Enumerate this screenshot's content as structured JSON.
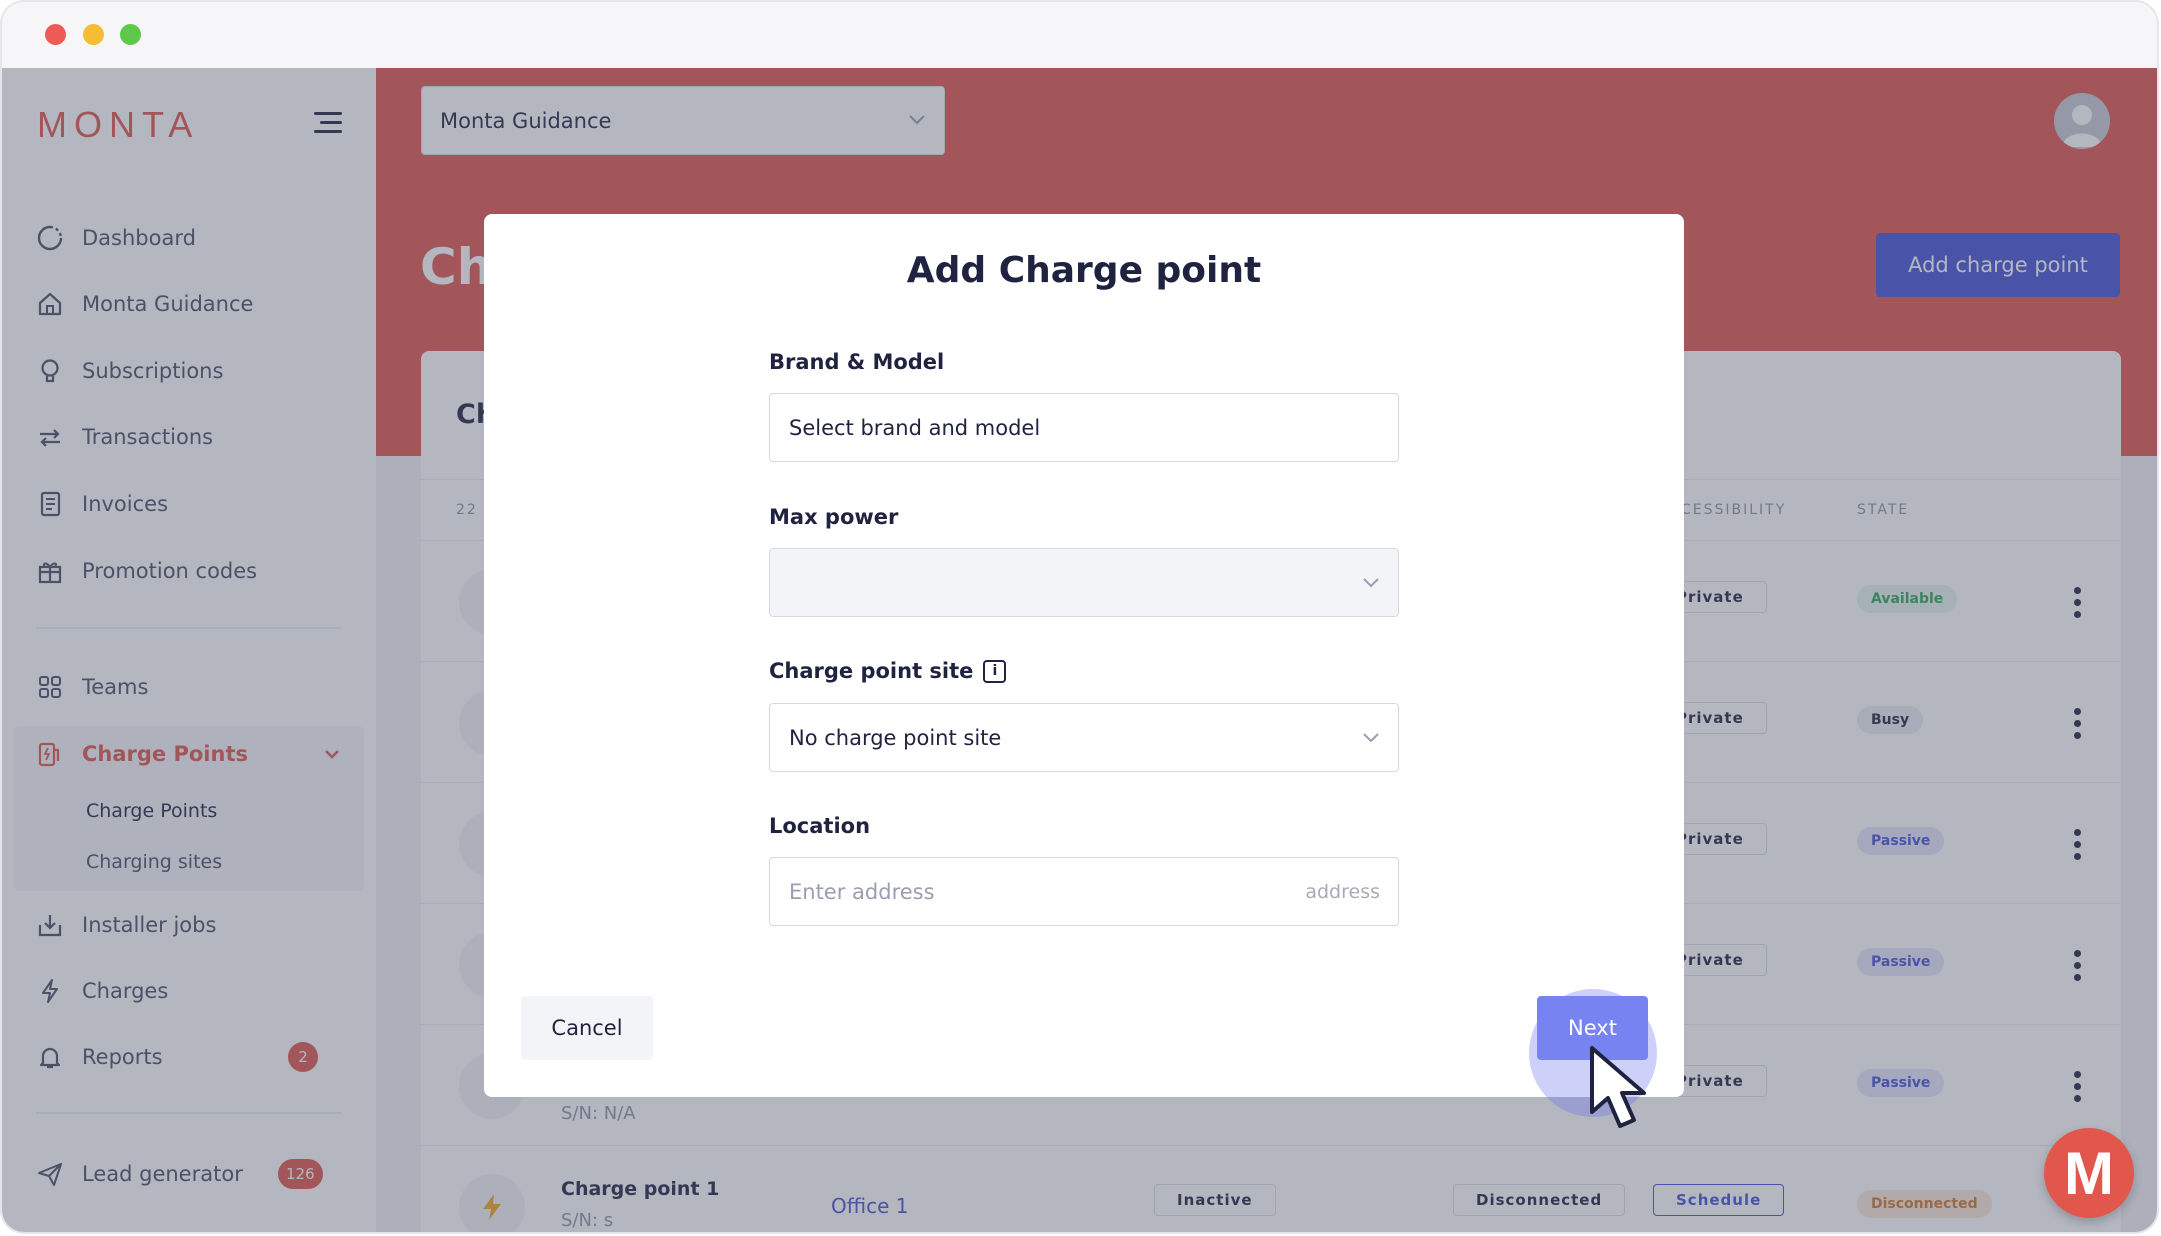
{
  "window": {
    "title": ""
  },
  "sidebar": {
    "logo": "MONTA",
    "items": [
      {
        "label": "Dashboard",
        "icon": "dashboard-icon"
      },
      {
        "label": "Monta Guidance",
        "icon": "home-icon"
      },
      {
        "label": "Subscriptions",
        "icon": "bulb-icon"
      },
      {
        "label": "Transactions",
        "icon": "arrows-icon"
      },
      {
        "label": "Invoices",
        "icon": "invoice-icon"
      },
      {
        "label": "Promotion codes",
        "icon": "gift-icon"
      },
      {
        "label": "Teams",
        "icon": "grid-icon"
      },
      {
        "label": "Charge Points",
        "icon": "charger-icon"
      },
      {
        "label": "Installer jobs",
        "icon": "download-icon"
      },
      {
        "label": "Charges",
        "icon": "bolt-icon"
      },
      {
        "label": "Reports",
        "icon": "bell-icon",
        "badge": "2"
      },
      {
        "label": "Lead generator",
        "icon": "send-icon",
        "badge": "126"
      }
    ],
    "sub_items": [
      "Charge Points",
      "Charging sites"
    ]
  },
  "header": {
    "team_select": "Monta Guidance",
    "page_title": "Ch",
    "add_button": "Add charge point"
  },
  "table": {
    "card_title": "Ch",
    "count_prefix": "22",
    "columns": {
      "accessibility": "CESSIBILITY",
      "state": "STATE"
    },
    "rows": [
      {
        "accessibility": "Private",
        "state": "Available"
      },
      {
        "accessibility": "Private",
        "state": "Busy"
      },
      {
        "accessibility": "Private",
        "state": "Passive"
      },
      {
        "accessibility": "Private",
        "state": "Passive"
      },
      {
        "accessibility": "Private",
        "state": "Passive",
        "serial": "S/N: N/A"
      },
      {
        "name": "Charge point 1",
        "serial": "S/N: s",
        "site": "Office 1",
        "status": "Inactive",
        "connection": "Disconnected",
        "accessibility": "Schedule",
        "state": "Disconnected"
      }
    ]
  },
  "modal": {
    "title": "Add Charge point",
    "brand_label": "Brand & Model",
    "brand_value": "Select brand and model",
    "power_label": "Max power",
    "power_value": "",
    "site_label": "Charge point site",
    "site_value": "No charge point site",
    "location_label": "Location",
    "location_placeholder": "Enter address",
    "location_suffix": "address",
    "cancel": "Cancel",
    "next": "Next"
  },
  "colors": {
    "brand": "#e2574c",
    "primary": "#4353d6",
    "next": "#7683f0"
  }
}
